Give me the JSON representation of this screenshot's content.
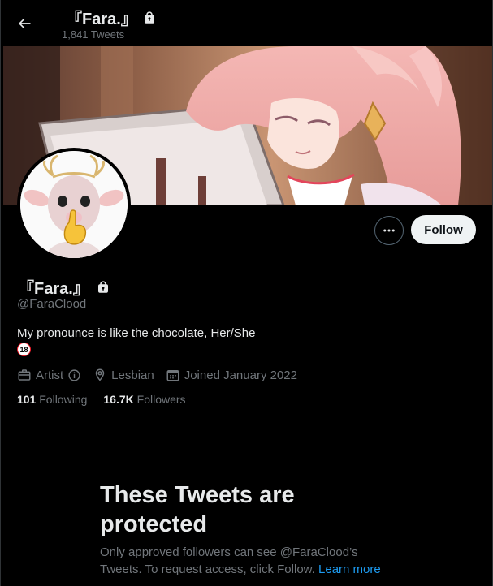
{
  "header": {
    "title": "『Fara.』",
    "tweet_count": "1,841 Tweets"
  },
  "actions": {
    "follow_label": "Follow"
  },
  "profile": {
    "name": "『Fara.』",
    "handle": "@FaraClood",
    "bio": "My pronounce is like the chocolate, Her/She",
    "bio_badge": "18",
    "profession": "Artist",
    "location": "Lesbian",
    "joined": "Joined January 2022",
    "following_count": "101",
    "following_label": "Following",
    "followers_count": "16.7K",
    "followers_label": "Followers"
  },
  "protected": {
    "title": "These Tweets are protected",
    "body": "Only approved followers can see @FaraClood’s Tweets. To request access, click Follow.",
    "learn_more": "Learn more"
  },
  "icons": {
    "back": "arrow-left-icon",
    "lock": "lock-icon",
    "more": "ellipsis-icon",
    "briefcase": "briefcase-icon",
    "info": "info-icon",
    "location": "location-pin-icon",
    "calendar": "calendar-icon"
  },
  "colors": {
    "background": "#000000",
    "text_primary": "#e7e9ea",
    "text_secondary": "#71767b",
    "accent": "#1d9bf0",
    "follow_bg": "#eff3f4"
  }
}
